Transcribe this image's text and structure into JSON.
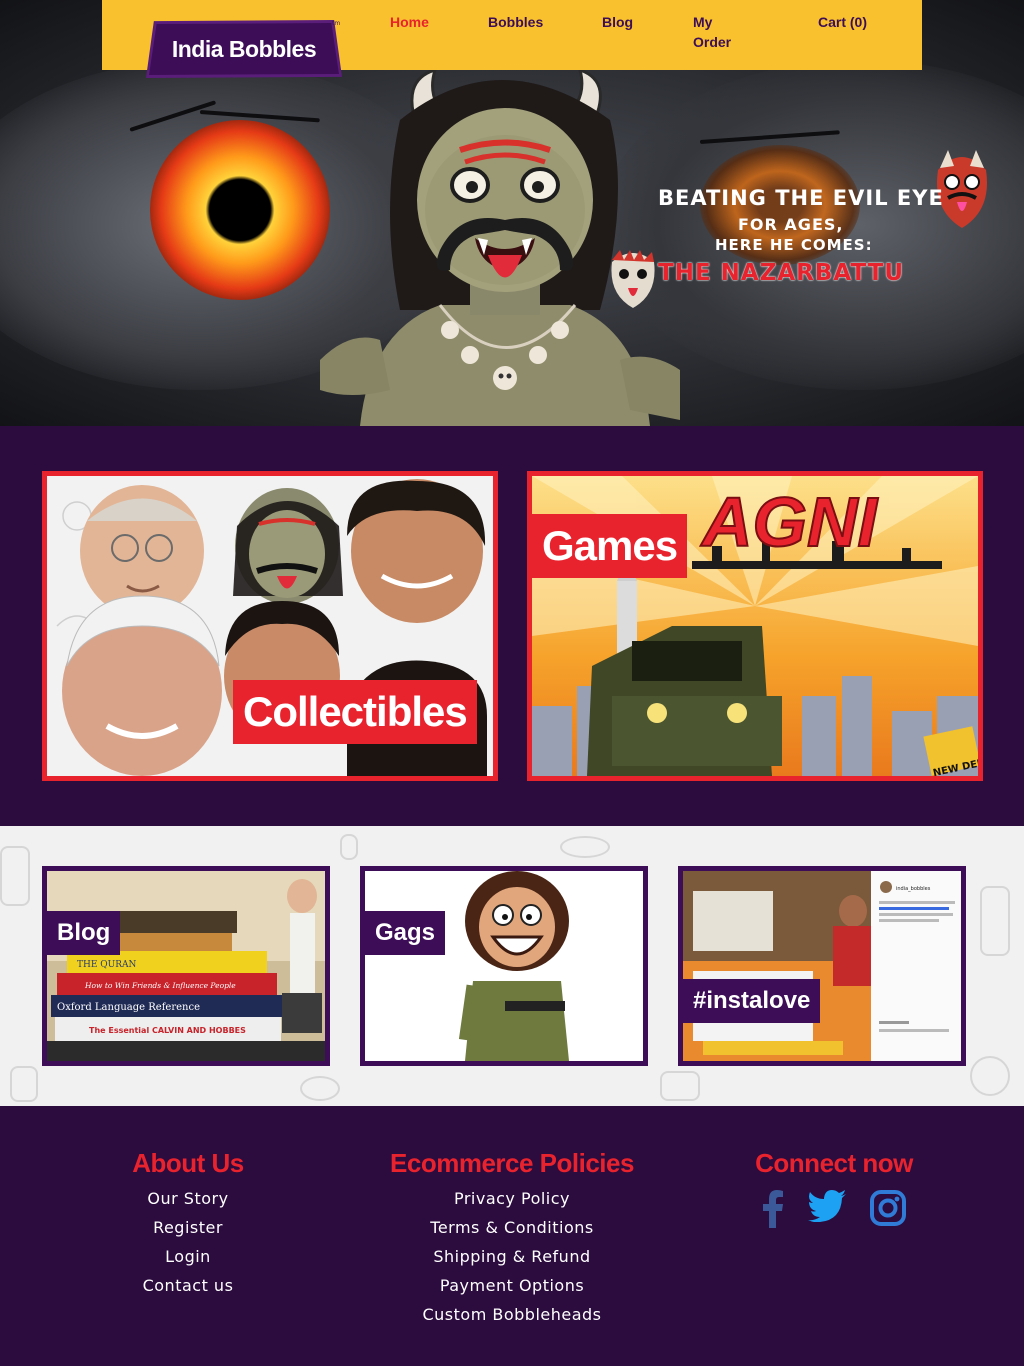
{
  "brand": {
    "name": "India Bobbles",
    "tm": "tm"
  },
  "nav": {
    "items": [
      {
        "label": "Home",
        "active": true
      },
      {
        "label": "Bobbles"
      },
      {
        "label": "Blog"
      },
      {
        "label": "My Order",
        "line1": "My",
        "line2": "Order"
      },
      {
        "label": "Cart (0)"
      }
    ]
  },
  "hero": {
    "line1": "BEATING THE EVIL EYE",
    "line2": "FOR AGES,",
    "line3": "HERE HE COMES:",
    "line4": "THE NAZARBATTU"
  },
  "feature": {
    "collectibles_label": "Collectibles",
    "games_label": "Games",
    "game_title": "AGNI",
    "game_badge": "NEW DELHI"
  },
  "mini": {
    "blog_label": "Blog",
    "gags_label": "Gags",
    "insta_label": "#instalove",
    "books": [
      "THE QURAN",
      "How to Win Friends & Influence People",
      "Oxford Language Reference",
      "The Essential CALVIN AND HOBBES"
    ],
    "insta_user": "india_bobbles"
  },
  "footer": {
    "about": {
      "title": "About Us",
      "links": [
        "Our Story",
        "Register",
        "Login",
        "Contact us"
      ]
    },
    "policies": {
      "title": "Ecommerce Policies",
      "links": [
        "Privacy Policy",
        "Terms & Conditions",
        "Shipping & Refund",
        "Payment Options",
        "Custom Bobbleheads"
      ]
    },
    "connect": {
      "title": "Connect now",
      "icons": [
        "facebook-icon",
        "twitter-icon",
        "instagram-icon"
      ]
    }
  },
  "colors": {
    "purple": "#2c0b3e",
    "yellow": "#fac12e",
    "red": "#e8232e",
    "facebook": "#3b5998",
    "twitter": "#1da1f2",
    "instagram": "#2f7bd6"
  }
}
